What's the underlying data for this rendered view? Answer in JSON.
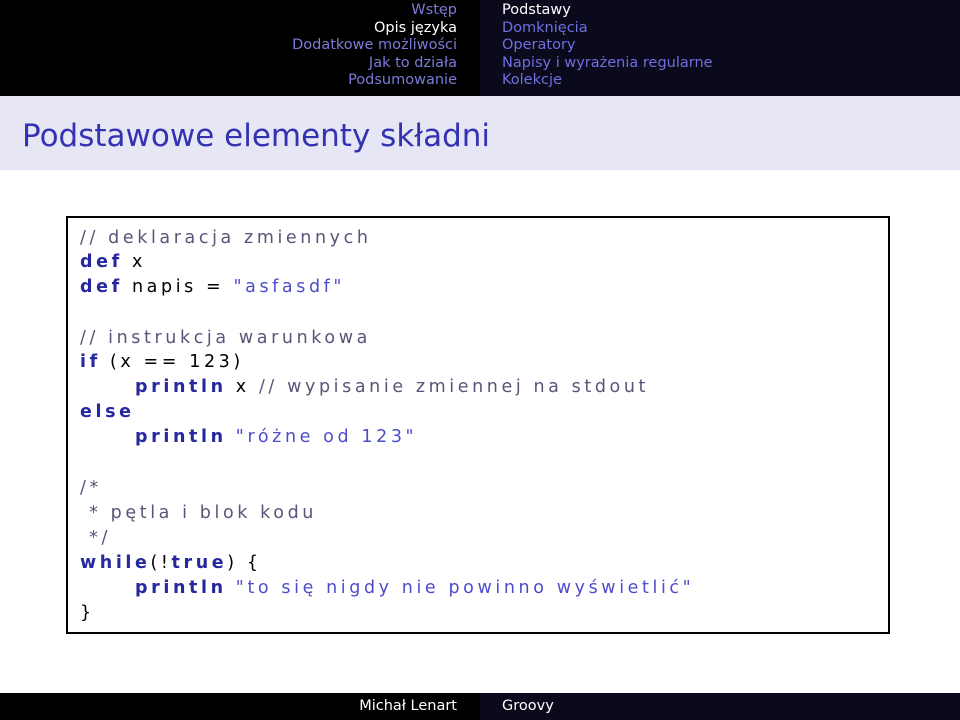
{
  "nav": {
    "sections": [
      "Wstęp",
      "Opis języka",
      "Dodatkowe możliwości",
      "Jak to działa",
      "Podsumowanie"
    ],
    "subsections": [
      "Podstawy",
      "Domknięcia",
      "Operatory",
      "Napisy i wyrażenia regularne",
      "Kolekcje"
    ]
  },
  "frame": {
    "title": "Podstawowe elementy składni"
  },
  "code": {
    "l1": "// deklaracja zmiennych",
    "l2_kw": "def",
    "l2_rest": " x",
    "l3_kw": "def",
    "l3_rest": " napis = ",
    "l3_str": "\"asfasdf\"",
    "l4_cm": "// instrukcja warunkowa",
    "l5_kw": "if",
    "l5_rest": " (x == 123)",
    "l6_kw": "println",
    "l6_rest": " x ",
    "l6_cm": "// wypisanie zmiennej na stdout",
    "l7_kw": "else",
    "l8_kw": "println",
    "l8_str": " \"różne od 123\"",
    "l9_cm": "/*",
    "l10_cm": " * pętla i blok kodu",
    "l11_cm": " */",
    "l12_kw": "while",
    "l12_rest": "(!",
    "l12_kw2": "true",
    "l12_rest2": ") {",
    "l13_kw": "println",
    "l13_str": " \"to się nigdy nie powinno wyświetlić\"",
    "l14": "}"
  },
  "footer": {
    "author": "Michał Lenart",
    "title": "Groovy"
  },
  "colors": {
    "bar": "#000000",
    "title_band": "#e6e6f5",
    "title_text": "#3333b2",
    "keyword": "#2727a0",
    "string": "#4d4dcc",
    "comment": "#56567a"
  }
}
